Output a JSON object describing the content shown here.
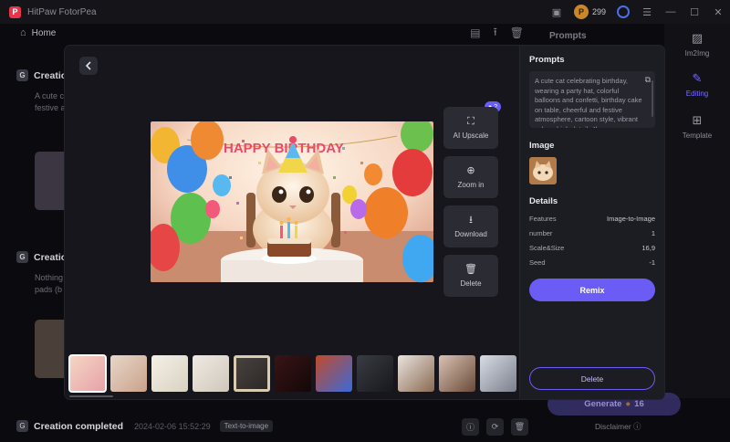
{
  "app": {
    "title": "HitPaw FotorPea",
    "logo_letter": "P",
    "coins": "299",
    "coin_symbol": "P",
    "window_controls": [
      "—",
      "☐",
      "✕"
    ],
    "home": "Home"
  },
  "background": {
    "card1_title": "Creation",
    "card1_text1": "A cute c",
    "card1_text2": "festive a",
    "card2_title": "Creation",
    "card2_text1": "Nothing",
    "card2_text2": "pads (b",
    "gen_label": "Generate",
    "gen_cost": "16",
    "disclaimer": "Disclaimer",
    "rail_prompts": "Prompts",
    "rail_items": [
      "Im2Img",
      "Editing",
      "Template"
    ],
    "bottom_title": "Creation completed",
    "bottom_date": "2024-02-06 15:52:29",
    "bottom_tag": "Text-to-image"
  },
  "modal": {
    "actions": [
      {
        "label": "AI Upscale",
        "icon": "⛶"
      },
      {
        "label": "Zoom in",
        "icon": "⊕"
      },
      {
        "label": "Download",
        "icon": "⭳"
      },
      {
        "label": "Delete",
        "icon": "🗑"
      }
    ],
    "badge_count": "2",
    "banner_text": "HAPPY BIRTHDAY",
    "panel": {
      "prompts_heading": "Prompts",
      "prompt_text": "A cute cat celebrating birthday, wearing a party hat, colorful balloons and confetti, birthday cake on table, cheerful and festive atmosphere, cartoon style, vibrant colors, high detail, 4k",
      "image_heading": "Image",
      "details_heading": "Details",
      "details": [
        {
          "k": "Features",
          "v": "Image-to-Image"
        },
        {
          "k": "number",
          "v": "1"
        },
        {
          "k": "Scale&Size",
          "v": "16,9"
        },
        {
          "k": "Seed",
          "v": "-1"
        }
      ],
      "remix_label": "Remix",
      "delete_label": "Delete"
    }
  },
  "colors": {
    "accent": "#6b5cf5",
    "modal_bg": "#16161c",
    "panel_bg": "#1c1c23",
    "app_bg": "#0b0b0f"
  }
}
